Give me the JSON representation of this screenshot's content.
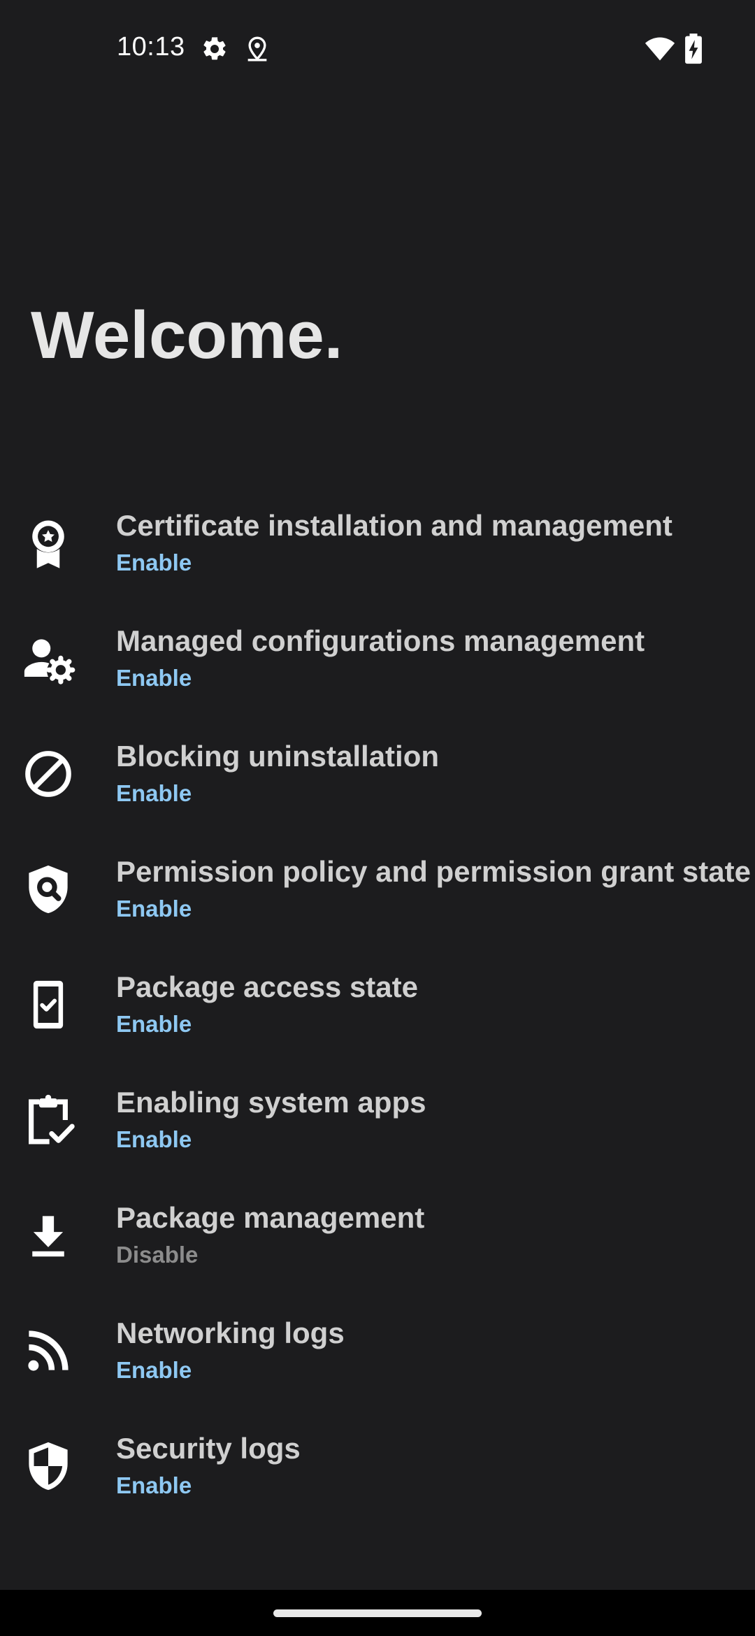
{
  "status_bar": {
    "time": "10:13",
    "icons": [
      "gear-icon",
      "location-icon",
      "wifi-icon",
      "battery-charging-icon"
    ]
  },
  "page": {
    "title": "Welcome."
  },
  "colors": {
    "background": "#1c1c1e",
    "title": "#e6e6e6",
    "item_title": "#d0d0d0",
    "enable_action": "#8ec8f2",
    "disable_action": "#8c8c8c"
  },
  "features": [
    {
      "title": "Certificate installation and management",
      "action": "Enable",
      "icon": "certificate-award-icon"
    },
    {
      "title": "Managed configurations management",
      "action": "Enable",
      "icon": "user-settings-icon"
    },
    {
      "title": "Blocking uninstallation",
      "action": "Enable",
      "icon": "block-icon"
    },
    {
      "title": "Permission policy and permission grant state",
      "action": "Enable",
      "icon": "shield-search-icon"
    },
    {
      "title": "Package access state",
      "action": "Enable",
      "icon": "phone-check-icon"
    },
    {
      "title": "Enabling system apps",
      "action": "Enable",
      "icon": "clipboard-check-icon"
    },
    {
      "title": "Package management",
      "action": "Disable",
      "icon": "download-icon"
    },
    {
      "title": "Networking logs",
      "action": "Enable",
      "icon": "rss-feed-icon"
    },
    {
      "title": "Security logs",
      "action": "Enable",
      "icon": "security-shield-icon"
    }
  ]
}
